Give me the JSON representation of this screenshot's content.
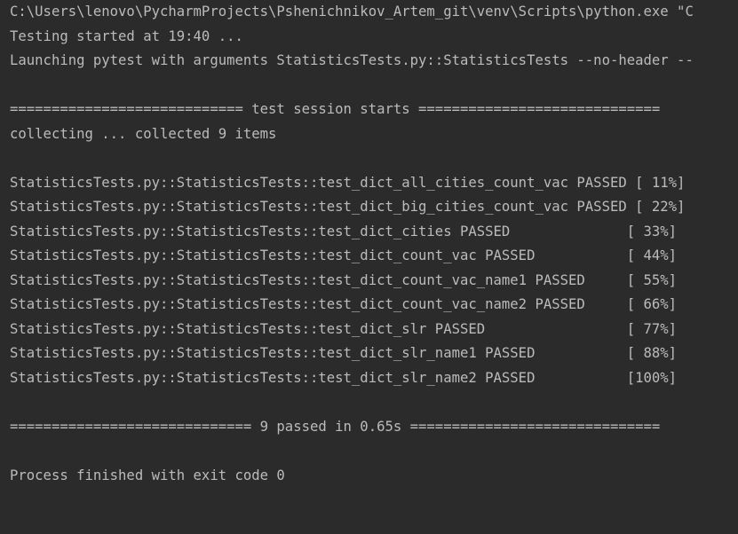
{
  "console": {
    "lines": [
      "C:\\Users\\lenovo\\PycharmProjects\\Pshenichnikov_Artem_git\\venv\\Scripts\\python.exe \"C",
      "Testing started at 19:40 ...",
      "Launching pytest with arguments StatisticsTests.py::StatisticsTests --no-header --",
      "",
      "============================ test session starts =============================",
      "collecting ... collected 9 items",
      "",
      "StatisticsTests.py::StatisticsTests::test_dict_all_cities_count_vac PASSED [ 11%]",
      "StatisticsTests.py::StatisticsTests::test_dict_big_cities_count_vac PASSED [ 22%]",
      "StatisticsTests.py::StatisticsTests::test_dict_cities PASSED              [ 33%]",
      "StatisticsTests.py::StatisticsTests::test_dict_count_vac PASSED           [ 44%]",
      "StatisticsTests.py::StatisticsTests::test_dict_count_vac_name1 PASSED     [ 55%]",
      "StatisticsTests.py::StatisticsTests::test_dict_count_vac_name2 PASSED     [ 66%]",
      "StatisticsTests.py::StatisticsTests::test_dict_slr PASSED                 [ 77%]",
      "StatisticsTests.py::StatisticsTests::test_dict_slr_name1 PASSED           [ 88%]",
      "StatisticsTests.py::StatisticsTests::test_dict_slr_name2 PASSED           [100%]",
      "",
      "============================= 9 passed in 0.65s ==============================",
      "",
      "Process finished with exit code 0"
    ]
  }
}
